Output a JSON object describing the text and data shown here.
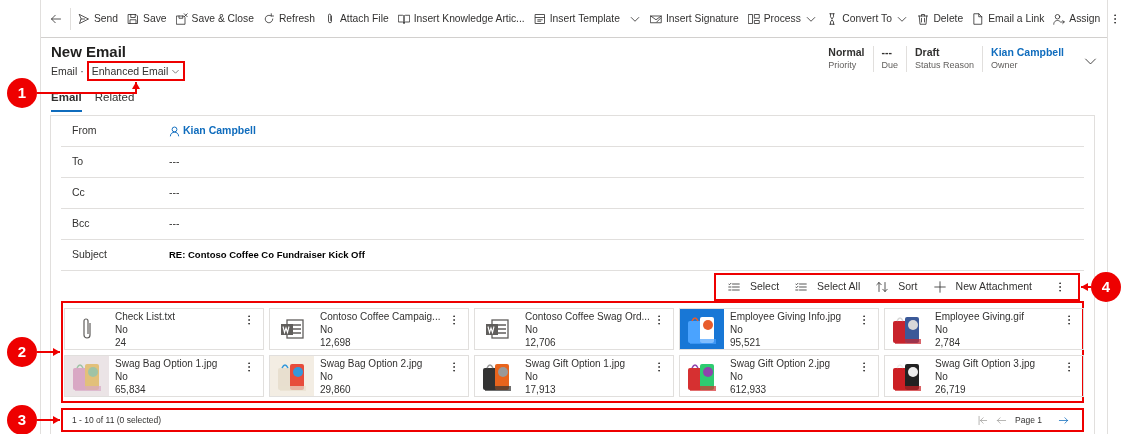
{
  "command_bar": [
    {
      "kind": "back"
    },
    {
      "kind": "send",
      "label": "Send"
    },
    {
      "kind": "save",
      "label": "Save"
    },
    {
      "kind": "save-close",
      "label": "Save & Close"
    },
    {
      "kind": "refresh",
      "label": "Refresh"
    },
    {
      "kind": "attach",
      "label": "Attach File"
    },
    {
      "kind": "knowledge",
      "label": "Insert Knowledge Artic..."
    },
    {
      "kind": "template",
      "label": "Insert Template"
    },
    {
      "kind": "split-chevron"
    },
    {
      "kind": "signature",
      "label": "Insert Signature"
    },
    {
      "kind": "process",
      "label": "Process"
    },
    {
      "kind": "chevron"
    },
    {
      "kind": "convert",
      "label": "Convert To"
    },
    {
      "kind": "chevron"
    },
    {
      "kind": "delete",
      "label": "Delete"
    },
    {
      "kind": "link",
      "label": "Email a Link"
    },
    {
      "kind": "assign",
      "label": "Assign"
    },
    {
      "kind": "more"
    }
  ],
  "header": {
    "title": "New Email",
    "entity": "Email",
    "separator": "·",
    "view_selector": {
      "label": "Enhanced Email",
      "callout": "1"
    },
    "fields": [
      {
        "value": "Normal",
        "label": "Priority",
        "kind": "text"
      },
      {
        "value": "---",
        "label": "Due",
        "kind": "text"
      },
      {
        "value": "Draft",
        "label": "Status Reason",
        "kind": "text"
      },
      {
        "value": "Kian Campbell",
        "label": "Owner",
        "kind": "link"
      }
    ]
  },
  "tabs": [
    {
      "label": "Email",
      "selected": true
    },
    {
      "label": "Related",
      "selected": false
    }
  ],
  "form": [
    {
      "label": "From",
      "value": "Kian Campbell",
      "kind": "person"
    },
    {
      "label": "To",
      "value": "---",
      "kind": "text"
    },
    {
      "label": "Cc",
      "value": "---",
      "kind": "text"
    },
    {
      "label": "Bcc",
      "value": "---",
      "kind": "text"
    },
    {
      "label": "Subject",
      "value": "RE: Contoso Coffee Co Fundraiser Kick Off",
      "kind": "bold"
    }
  ],
  "attachment_toolbar": {
    "callout": "4",
    "items": [
      {
        "kind": "select",
        "label": "Select"
      },
      {
        "kind": "select-all",
        "label": "Select All"
      },
      {
        "kind": "sort",
        "label": "Sort"
      },
      {
        "kind": "add",
        "label": "New Attachment"
      },
      {
        "kind": "more"
      }
    ]
  },
  "attachments": {
    "callout": "2",
    "items": [
      {
        "kind": "text-file",
        "line_1": "Check List.txt",
        "line_2": "No",
        "line_3": "24"
      },
      {
        "kind": "word-file",
        "line_1": "Contoso Coffee Campaig...",
        "line_2": "No",
        "line_3": "12,698"
      },
      {
        "kind": "word-file",
        "line_1": "Contoso Coffee Swag Ord...",
        "line_2": "No",
        "line_3": "12,706"
      },
      {
        "kind": "picture",
        "line_1": "Employee Giving Info.jpg",
        "line_2": "No",
        "line_3": "95,521"
      },
      {
        "kind": "picture",
        "line_1": "Employee Giving.gif",
        "line_2": "No",
        "line_3": "2,784"
      },
      {
        "kind": "picture",
        "line_1": "Swag Bag Option 1.jpg",
        "line_2": "No",
        "line_3": "65,834"
      },
      {
        "kind": "picture",
        "line_1": "Swag Bag Option 2.jpg",
        "line_2": "No",
        "line_3": "29,860"
      },
      {
        "kind": "picture",
        "line_1": "Swag Gift Option 1.jpg",
        "line_2": "No",
        "line_3": "17,913"
      },
      {
        "kind": "picture",
        "line_1": "Swag Gift Option 2.jpg",
        "line_2": "No",
        "line_3": "612,933"
      },
      {
        "kind": "picture",
        "line_1": "Swag Gift Option 3.jpg",
        "line_2": "No",
        "line_3": "26,719"
      }
    ]
  },
  "pager": {
    "callout": "3",
    "summary": "1 - 10 of 11 (0 selected)",
    "page": "Page 1"
  }
}
